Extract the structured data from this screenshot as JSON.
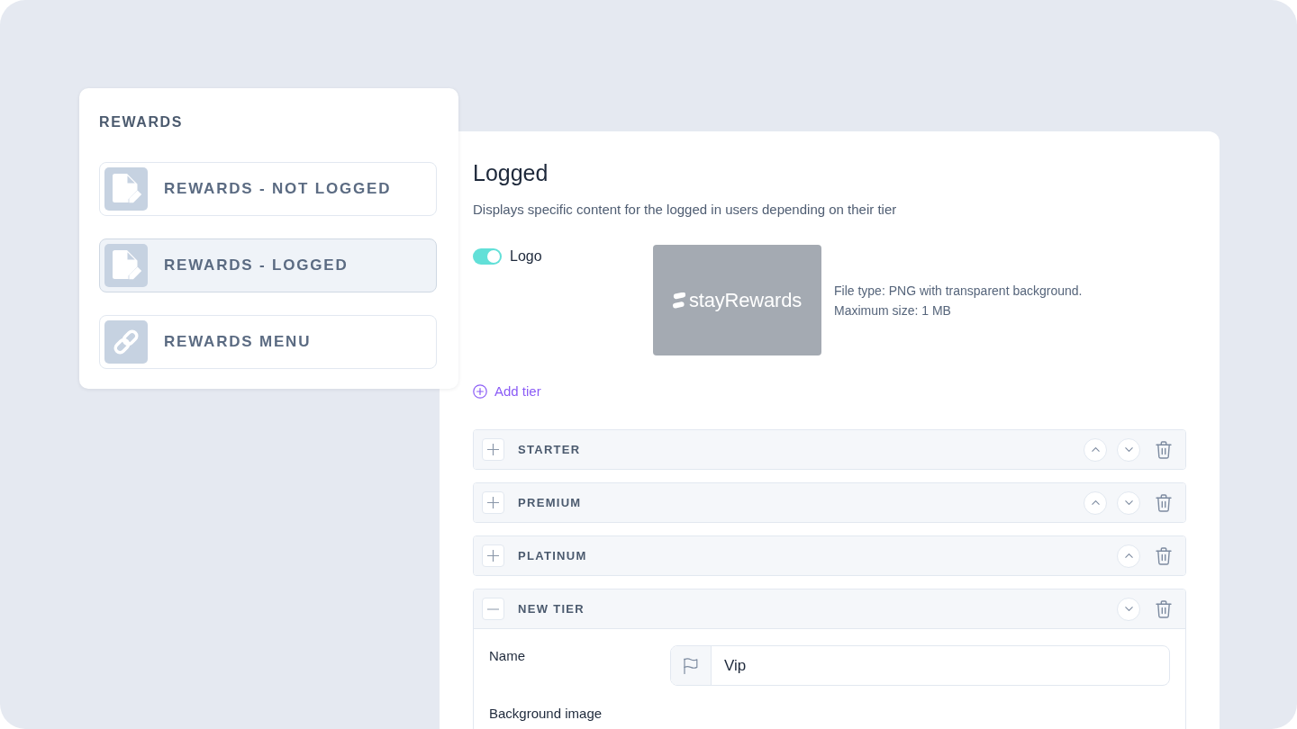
{
  "sidebar": {
    "title": "REWARDS",
    "items": [
      {
        "kind": "page",
        "label": "REWARDS - NOT LOGGED",
        "selected": false
      },
      {
        "kind": "page",
        "label": "REWARDS - LOGGED",
        "selected": true
      },
      {
        "kind": "link",
        "label": "REWARDS MENU",
        "selected": false
      }
    ]
  },
  "content": {
    "title": "Logged",
    "description": "Displays specific content for the logged in users depending on their tier",
    "logo": {
      "label": "Logo",
      "on": true,
      "preview_text": "stayRewards",
      "hints": [
        "File type: PNG with transparent background.",
        "Maximum size: 1 MB"
      ]
    },
    "add_button": "Add tier",
    "tiers": [
      {
        "name": "STARTER",
        "expanded": false,
        "up_button": true,
        "down_button": true
      },
      {
        "name": "PREMIUM",
        "expanded": false,
        "up_button": true,
        "down_button": true
      },
      {
        "name": "PLATINUM",
        "expanded": false,
        "up_button": true,
        "down_button": false
      },
      {
        "name": "NEW TIER",
        "expanded": true,
        "up_button": false,
        "down_button": true,
        "fields": [
          {
            "kind": "text",
            "label": "Name",
            "value": "Vip"
          },
          {
            "kind": "image",
            "label": "Background image"
          }
        ]
      }
    ]
  }
}
